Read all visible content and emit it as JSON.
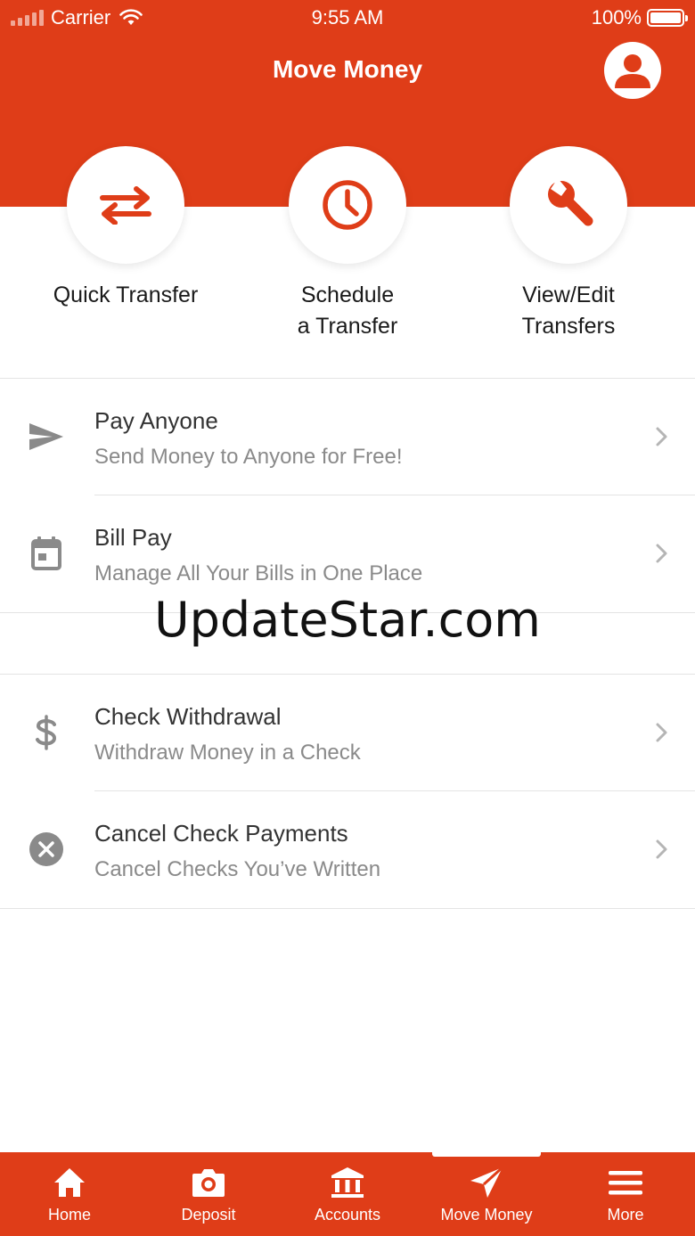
{
  "colors": {
    "brand": "#df3d18",
    "title_text": "#333333",
    "subtitle_text": "#8a8a8a",
    "icon_gray": "#8a8a8a",
    "background": "#ffffff"
  },
  "status_bar": {
    "carrier": "Carrier",
    "time": "9:55 AM",
    "battery": "100%"
  },
  "header": {
    "title": "Move Money",
    "profile_icon": "person-icon"
  },
  "quick_actions": [
    {
      "label": "Quick Transfer",
      "icon": "swap-arrows-icon"
    },
    {
      "label": "Schedule\na Transfer",
      "icon": "clock-icon"
    },
    {
      "label": "View/Edit\nTransfers",
      "icon": "wrench-icon"
    }
  ],
  "list_groups": [
    {
      "items": [
        {
          "title": "Pay Anyone",
          "subtitle": "Send Money to Anyone for Free!",
          "icon": "paper-plane-icon"
        },
        {
          "title": "Bill Pay",
          "subtitle": "Manage All Your Bills in One Place",
          "icon": "calendar-icon"
        }
      ]
    },
    {
      "items": [
        {
          "title": "Check Withdrawal",
          "subtitle": "Withdraw Money in a Check",
          "icon": "dollar-icon"
        },
        {
          "title": "Cancel Check Payments",
          "subtitle": "Cancel Checks You’ve Written",
          "icon": "cancel-circle-icon"
        }
      ]
    }
  ],
  "watermark": "UpdateStar.com",
  "tab_bar": {
    "tabs": [
      {
        "label": "Home",
        "icon": "home-icon"
      },
      {
        "label": "Deposit",
        "icon": "camera-icon"
      },
      {
        "label": "Accounts",
        "icon": "bank-icon"
      },
      {
        "label": "Move Money",
        "icon": "send-icon"
      },
      {
        "label": "More",
        "icon": "menu-icon"
      }
    ],
    "active": "Move Money"
  }
}
